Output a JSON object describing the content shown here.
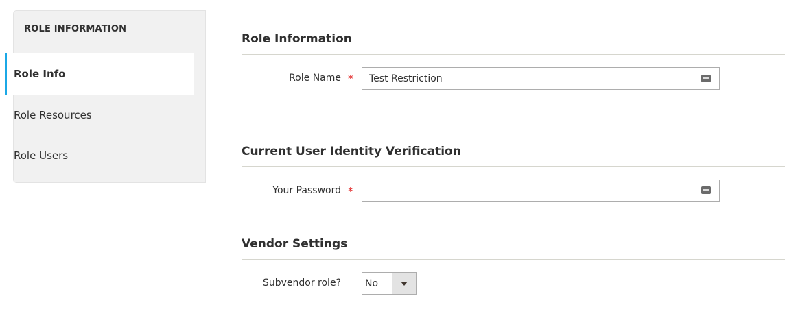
{
  "sidebar": {
    "title": "ROLE INFORMATION",
    "items": [
      {
        "label": "Role Info",
        "active": true
      },
      {
        "label": "Role Resources",
        "active": false
      },
      {
        "label": "Role Users",
        "active": false
      }
    ]
  },
  "sections": {
    "role_information": {
      "title": "Role Information",
      "role_name_label": "Role Name",
      "role_name_value": "Test Restriction"
    },
    "identity": {
      "title": "Current User Identity Verification",
      "password_label": "Your Password",
      "password_value": ""
    },
    "vendor": {
      "title": "Vendor Settings",
      "subvendor_label": "Subvendor role?",
      "subvendor_value": "No"
    }
  },
  "required_marker": "*",
  "colors": {
    "accent": "#1ba8e6",
    "required": "#e22626",
    "sidebar_bg": "#f1f1f1"
  },
  "icons": {
    "field_autofill": "password-manager-icon",
    "select_arrow": "chevron-down-icon"
  }
}
